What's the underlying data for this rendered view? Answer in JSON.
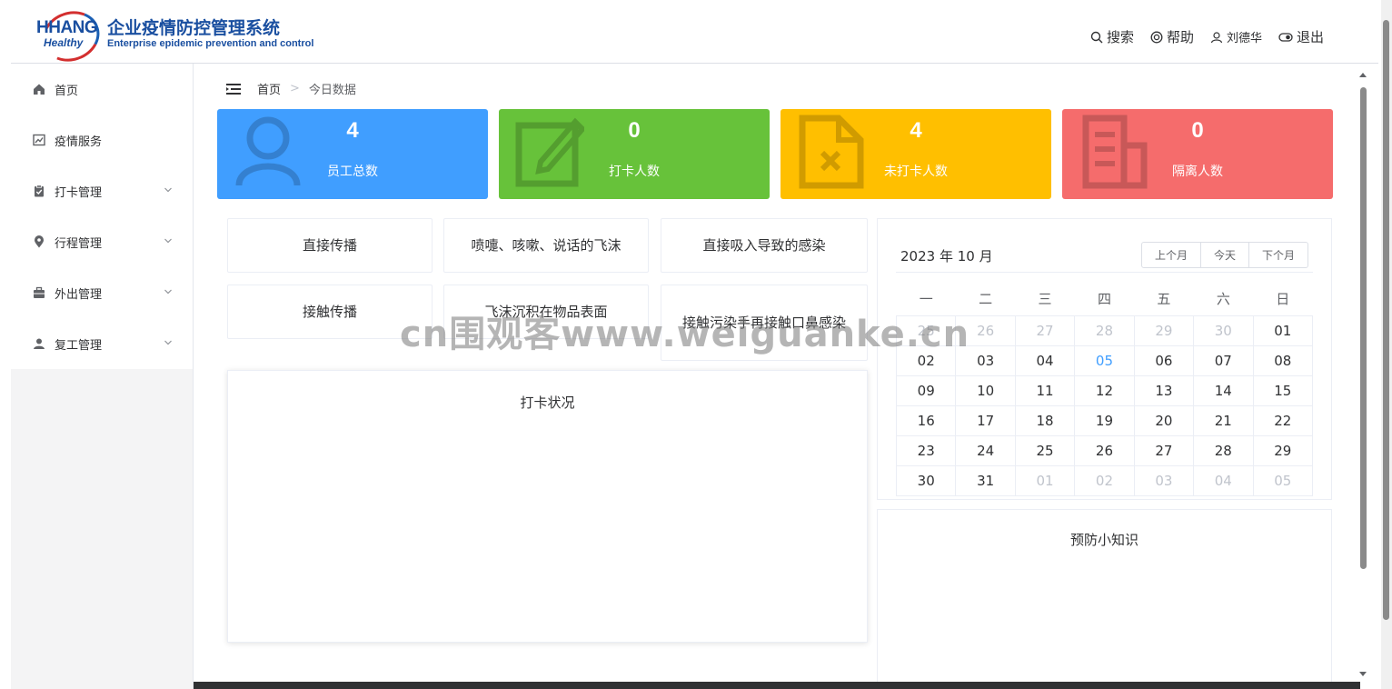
{
  "header": {
    "logo_mark_line1": "HHANG",
    "logo_mark_line2": "Healthy",
    "logo_cn": "企业疫情防控管理系统",
    "logo_en": "Enterprise epidemic prevention and control",
    "search": "搜索",
    "help": "帮助",
    "user": "刘德华",
    "logout": "退出"
  },
  "sidebar": {
    "items": [
      {
        "label": "首页",
        "icon": "home-icon"
      },
      {
        "label": "疫情服务",
        "icon": "chart-icon"
      },
      {
        "label": "打卡管理",
        "icon": "clipboard-icon"
      },
      {
        "label": "行程管理",
        "icon": "location-icon"
      },
      {
        "label": "外出管理",
        "icon": "briefcase-icon"
      },
      {
        "label": "复工管理",
        "icon": "user-icon"
      }
    ]
  },
  "breadcrumb": {
    "home": "首页",
    "current": "今日数据"
  },
  "stats": [
    {
      "value": "4",
      "label": "员工总数",
      "color": "#409eff"
    },
    {
      "value": "0",
      "label": "打卡人数",
      "color": "#67c23a"
    },
    {
      "value": "4",
      "label": "未打卡人数",
      "color": "#ffbf00"
    },
    {
      "value": "0",
      "label": "隔离人数",
      "color": "#f56c6c"
    }
  ],
  "routes": [
    "直接传播",
    "喷嚏、咳嗽、说话的飞沫",
    "直接吸入导致的感染",
    "接触传播",
    "飞沫沉积在物品表面",
    "接触污染手再接触口鼻感染"
  ],
  "checkin_panel": {
    "title": "打卡状况"
  },
  "tips_panel": {
    "title": "预防小知识"
  },
  "calendar": {
    "title": "2023 年 10 月",
    "prev": "上个月",
    "today": "今天",
    "next": "下个月",
    "weekdays": [
      "一",
      "二",
      "三",
      "四",
      "五",
      "六",
      "日"
    ],
    "rows": [
      [
        "25",
        "26",
        "27",
        "28",
        "29",
        "30",
        "01"
      ],
      [
        "02",
        "03",
        "04",
        "05",
        "06",
        "07",
        "08"
      ],
      [
        "09",
        "10",
        "11",
        "12",
        "13",
        "14",
        "15"
      ],
      [
        "16",
        "17",
        "18",
        "19",
        "20",
        "21",
        "22"
      ],
      [
        "23",
        "24",
        "25",
        "26",
        "27",
        "28",
        "29"
      ],
      [
        "30",
        "31",
        "01",
        "02",
        "03",
        "04",
        "05"
      ]
    ]
  },
  "watermark": "cn围观客www.weiguanke.cn"
}
